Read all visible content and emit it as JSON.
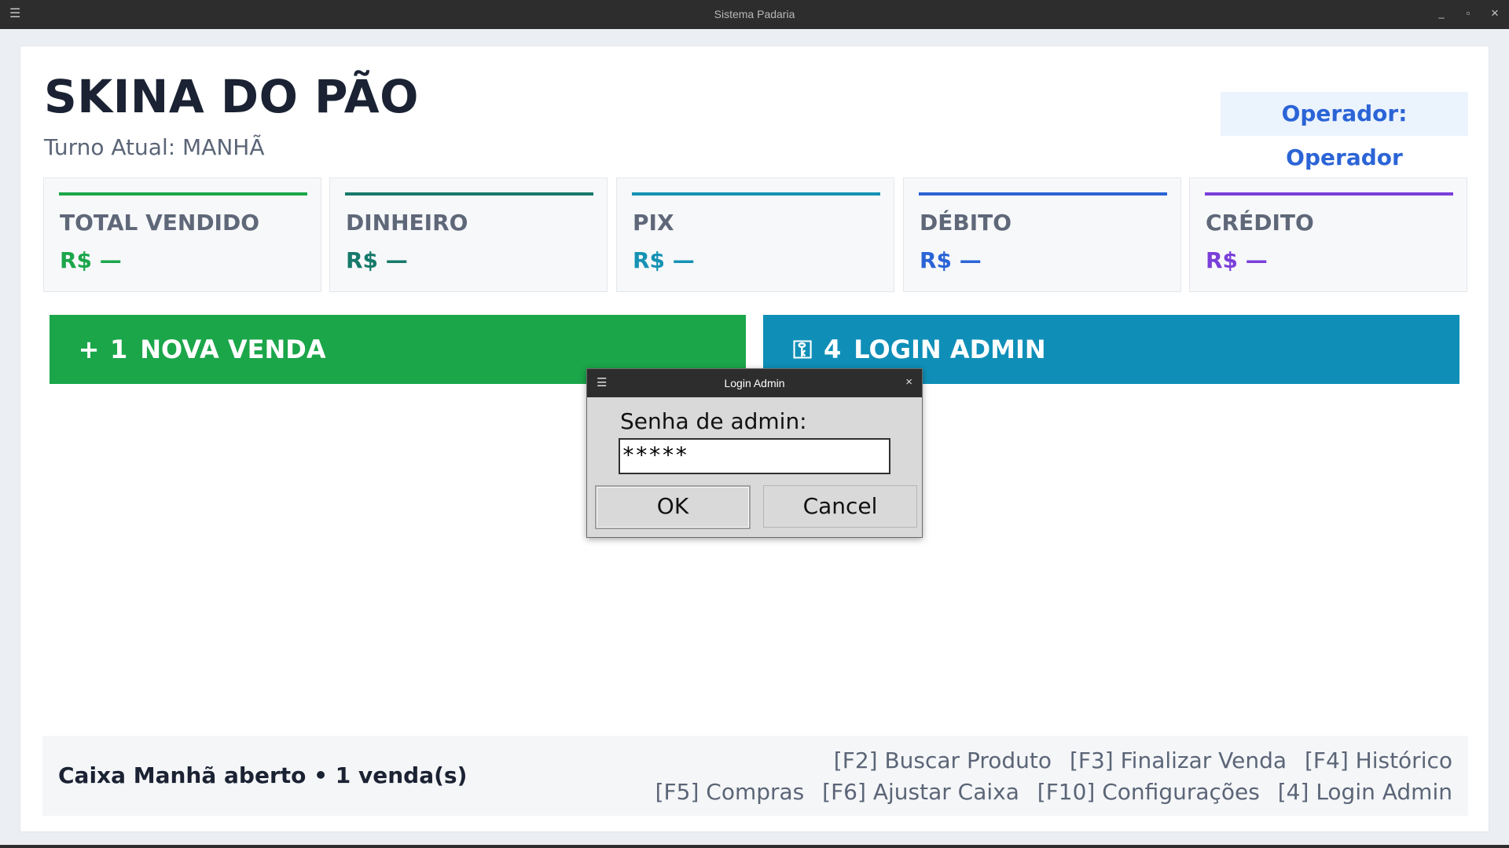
{
  "window": {
    "title": "Sistema Padaria",
    "menu_icon": "☰",
    "minimize_icon": "_",
    "maximize_icon": "▫",
    "close_icon": "×"
  },
  "header": {
    "app_title": "SKINA DO PÃO",
    "shift": "Turno Atual: MANHÃ",
    "operator": "Operador: Operador"
  },
  "cards": [
    {
      "label": "TOTAL VENDIDO",
      "value": "R$ —",
      "color": "#1ba64a"
    },
    {
      "label": "DINHEIRO",
      "value": "R$ —",
      "color": "#167a6b"
    },
    {
      "label": "PIX",
      "value": "R$ —",
      "color": "#1592b4"
    },
    {
      "label": "DÉBITO",
      "value": "R$ —",
      "color": "#2b64d6"
    },
    {
      "label": "CRÉDITO",
      "value": "R$ —",
      "color": "#7b3fd9"
    }
  ],
  "actions": {
    "new_sale": {
      "icon": "+",
      "number": "1",
      "label": "NOVA VENDA",
      "color": "#1ba64a"
    },
    "admin_login": {
      "icon": "⚿",
      "number": "4",
      "label": "LOGIN ADMIN",
      "color": "#0f8fb8"
    }
  },
  "footer": {
    "status": "Caixa Manhã aberto  •  1 venda(s)",
    "shortcuts_row1": [
      "[F2] Buscar Produto",
      "[F3] Finalizar Venda",
      "[F4] Histórico"
    ],
    "shortcuts_row2": [
      "[F5] Compras",
      "[F6] Ajustar Caixa",
      "[F10] Configurações",
      "[4] Login Admin"
    ]
  },
  "dialog": {
    "title": "Login Admin",
    "menu_icon": "☰",
    "close_icon": "×",
    "prompt": "Senha de admin:",
    "password_value": "*****",
    "ok_label": "OK",
    "cancel_label": "Cancel"
  }
}
